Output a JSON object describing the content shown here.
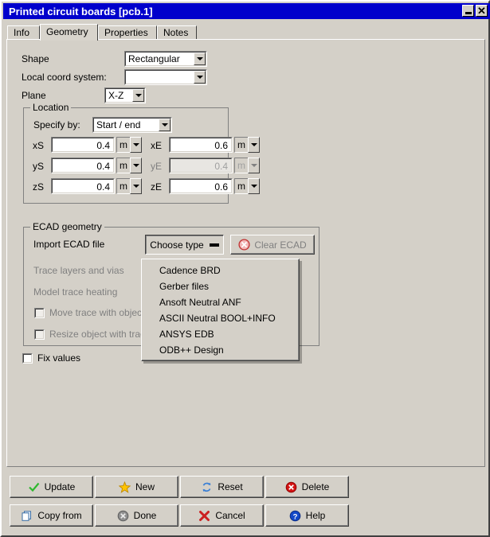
{
  "window": {
    "title": "Printed circuit boards [pcb.1]",
    "titlebar_color": "#0000cc",
    "minimize_icon": "minimize-icon",
    "close_icon": "close-icon",
    "close_glyph": "✕"
  },
  "tabs": [
    {
      "label": "Info",
      "active": false
    },
    {
      "label": "Geometry",
      "active": true
    },
    {
      "label": "Properties",
      "active": false
    },
    {
      "label": "Notes",
      "active": false
    }
  ],
  "form": {
    "shape": {
      "label": "Shape",
      "value": "Rectangular"
    },
    "local_coord_system": {
      "label": "Local coord system:",
      "value": ""
    },
    "plane": {
      "label": "Plane",
      "value": "X-Z"
    }
  },
  "location": {
    "group_title": "Location",
    "specify_by": {
      "label": "Specify by:",
      "value": "Start / end"
    },
    "rows": [
      {
        "start_label": "xS",
        "start_value": "0.4",
        "start_unit": "m",
        "start_disabled": false,
        "end_label": "xE",
        "end_value": "0.6",
        "end_unit": "m",
        "end_disabled": false
      },
      {
        "start_label": "yS",
        "start_value": "0.4",
        "start_unit": "m",
        "start_disabled": false,
        "end_label": "yE",
        "end_value": "0.4",
        "end_unit": "m",
        "end_disabled": true
      },
      {
        "start_label": "zS",
        "start_value": "0.4",
        "start_unit": "m",
        "start_disabled": false,
        "end_label": "zE",
        "end_value": "0.6",
        "end_unit": "m",
        "end_disabled": false
      }
    ]
  },
  "ecad": {
    "group_title": "ECAD geometry",
    "import_label": "Import ECAD file",
    "choose_type_button": "Choose type",
    "clear_button": "Clear ECAD",
    "clear_icon": "clear-ecad-icon",
    "trace_layers_label": "Trace layers and vias",
    "model_trace_label": "Model trace heating",
    "move_trace_label": "Move trace with object",
    "resize_object_label": "Resize object with trace"
  },
  "menu": {
    "items": [
      "Cadence BRD",
      "Gerber files",
      "Ansoft Neutral ANF",
      "ASCII Neutral BOOL+INFO",
      "ANSYS EDB",
      "ODB++ Design"
    ]
  },
  "fix_values": {
    "label": "Fix values",
    "checked": false
  },
  "buttons": [
    {
      "label": "Update",
      "icon": "check-icon"
    },
    {
      "label": "New",
      "icon": "star-icon"
    },
    {
      "label": "Reset",
      "icon": "refresh-icon"
    },
    {
      "label": "Delete",
      "icon": "delete-circle-icon"
    },
    {
      "label": "Copy from",
      "icon": "copy-icon"
    },
    {
      "label": "Done",
      "icon": "done-circle-icon"
    },
    {
      "label": "Cancel",
      "icon": "cancel-x-icon"
    },
    {
      "label": "Help",
      "icon": "help-circle-icon"
    }
  ],
  "colors": {
    "face": "#d4d0c8",
    "title": "#0000cc",
    "check_green": "#2eb82e",
    "star_yellow": "#ffc400",
    "reset_blue": "#3a7fd5",
    "delete_red": "#d41414",
    "help_blue": "#1449c8",
    "cancel_red": "#cc2020",
    "done_gray": "#888888"
  }
}
